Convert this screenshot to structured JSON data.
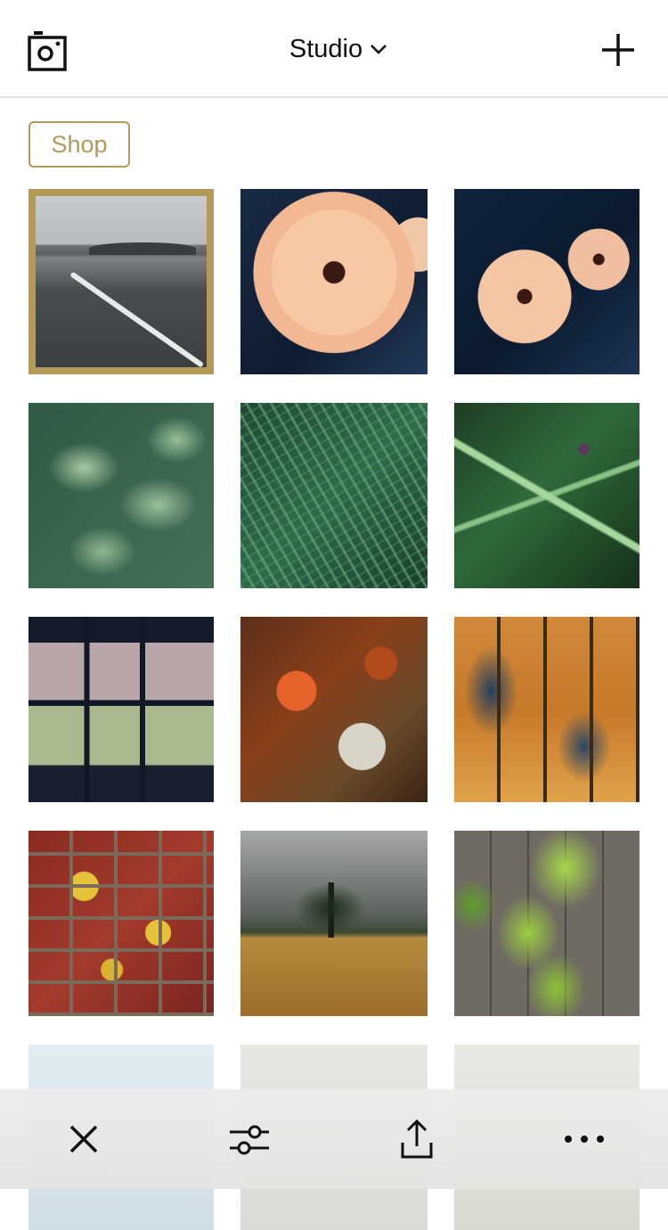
{
  "header": {
    "title": "Studio",
    "camera_icon": "camera-icon",
    "dropdown_icon": "chevron-down-icon",
    "add_icon": "plus-icon"
  },
  "shop": {
    "label": "Shop",
    "accent_color": "#b29a5a"
  },
  "grid": {
    "selected_index": 0,
    "selection_color": "#b39a58",
    "images": [
      "coastline-beach",
      "peach-dahlia",
      "two-dahlias",
      "hydrangea-leaves",
      "fern-fronds",
      "large-green-leaf",
      "greenhouse-window",
      "rusted-metal",
      "peeling-paint",
      "lichen-bricks",
      "tree-in-field",
      "ivy-on-fence",
      "overcast-sky",
      "overcast-sky",
      "overcast-sky"
    ]
  },
  "toolbar": {
    "close_icon": "close-icon",
    "adjust_icon": "sliders-icon",
    "share_icon": "share-icon",
    "more_icon": "more-icon"
  }
}
